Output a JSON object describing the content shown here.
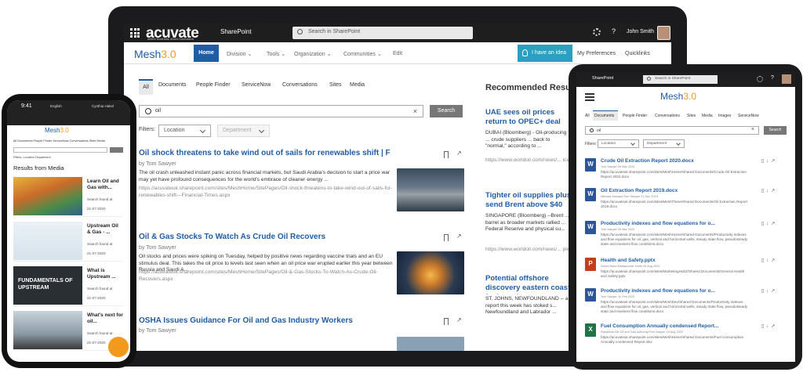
{
  "laptop": {
    "suitebar": {
      "brand": "acuvate",
      "brand_tagline": "where business drives innovation",
      "app": "SharePoint",
      "search_placeholder": "Search in SharePoint",
      "help": "?",
      "user": "John Smith"
    },
    "mesh": {
      "logo_main": "Mesh",
      "logo_ver": "3.0"
    },
    "nav": [
      "Home",
      "Division",
      "Tools",
      "Organization",
      "Communities",
      "Edit"
    ],
    "right_nav": {
      "idea": "I have an idea",
      "prefs": "My Preferences",
      "quick": "Quicklinks"
    },
    "tabs": [
      "All",
      "Documents",
      "People Finder",
      "ServiceNow",
      "Conversations",
      "Sites",
      "Media"
    ],
    "search": {
      "value": "oil",
      "button": "Search",
      "clear": "×"
    },
    "filters": {
      "label": "Filters:",
      "location": "Location",
      "department": "Department"
    },
    "results": [
      {
        "title": "Oil shock threatens to take wind out of sails for renewables shift | Fina...",
        "author": "by Tom Sawyer",
        "snippet": "The oil crash unleashed instant panic across financial markets, but Saudi Arabia's decision to start a price war may yet have profound consequences for the world's embrace of cleaner energy ...",
        "url": "https://acuvateuk.sharepoint.com/sites/MeshHome/SitePages/Oil-shock-threatens-to-take-wind-out-of-sails-for-renewables-shift---Financial-Times.aspx"
      },
      {
        "title": "Oil & Gas Stocks To Watch As Crude Oil Recovers",
        "author": "by Tom Sawyer",
        "snippet": "Oil stocks and prices were spiking on Tuesday, helped by positive news regarding vaccine trials and an EU stimulus deal. This takes the oil price to levels last seen when an oil price war erupted earlier this year between Russia and Saudi A...",
        "url": "https://acuvateuk.sharepoint.com/sites/MeshHome/SitePages/Oil-&-Gas-Stocks-To-Watch-As-Crude-Oil-Recovers.aspx"
      },
      {
        "title": "OSHA Issues Guidance For Oil and Gas Industry Workers",
        "author": "by Tom Sawyer"
      }
    ],
    "recommended": {
      "heading": "Recommended Results",
      "items": [
        {
          "title": "UAE sees oil prices return to OPEC+ deal",
          "body": "DUBAI (Bloomberg) - Oil-producing ... crude suppliers ... back to \"normal,\" according to ...",
          "url": "https://www.worldoil.com/news/... ices-returning-to-normal-on-opec"
        },
        {
          "title": "Tighter oil supplies plus send Brent above $40",
          "body": "SINGAPORE (Bloomberg) --Brent ... barrel as broader markets rallied ... Federal Reserve and physical su...",
          "url": "https://www.worldoil.com/news/... plies-plus-us-stimulus-efforts-se"
        },
        {
          "title": "Potential offshore discovery eastern coast fuels optim",
          "body": "ST. JOHNS, NEWFOUNDLAND -- a report this week has stoked s... Newfoundland and Labrador ..."
        }
      ]
    }
  },
  "phone": {
    "time": "9:41",
    "language": "English",
    "user": "Cynthia Hakel",
    "mesh_logo_main": "Mesh",
    "mesh_logo_ver": "3.0",
    "tabs": "All  Documents  People Finder  ServiceNow  Conversations  Sites  Media",
    "filters": "Filters:  Location  Department",
    "results_heading": "Results from Media",
    "cards": [
      {
        "title": "Learn Oil and Gas with...",
        "meta": "Search found at",
        "date": "21-07-2020"
      },
      {
        "title": "Upstream Oil & Gas - ...",
        "meta": "Search found at",
        "date": "21-07-2020"
      },
      {
        "title": "What is Upstream ...",
        "meta": "Search found at",
        "date": "21-07-2020",
        "thumb_text": "FUNDAMENTALS OF UPSTREAM"
      },
      {
        "title": "What's next for oil...",
        "meta": "Search found at",
        "date": "21-07-2020"
      }
    ]
  },
  "tablet": {
    "app": "SharePoint",
    "search_placeholder": "Search in SharePoint",
    "help": "?",
    "mesh_logo_main": "Mesh",
    "mesh_logo_ver": "3.0",
    "tabs": [
      "All",
      "Documents",
      "People Finder",
      "Conversations",
      "Sites",
      "Media",
      "Images",
      "ServiceNow"
    ],
    "search": {
      "value": "oil",
      "button": "Search",
      "clear": "×"
    },
    "filters": {
      "label": "Filters:",
      "location": "Location",
      "department": "Department"
    },
    "docs": [
      {
        "icon": "W",
        "color": "#2b579a",
        "title": "Crude Oil Extraction Report 2020.docx",
        "meta": "Tom Sawyer                09 Mar 2020",
        "url": "https://acuvateuk.sharepoint.com/sites/MeshHome/Shared Documents/Crude Oil Extraction Report 2020.docx"
      },
      {
        "icon": "W",
        "color": "#2b579a",
        "title": "Oil Extraction Report 2019.docx",
        "meta": "Manasa Manapu/Tom Sawyer              21 Dec 2019",
        "url": "https://acuvateuk.sharepoint.com/sites/MeshThree/Shared Documents/Oil Extraction Report 2019.docx"
      },
      {
        "icon": "W",
        "color": "#2b579a",
        "title": "Productivity indexes and flow equations for o...",
        "meta": "Tom Sawyer                09 Mar 2020",
        "url": "https://acuvateuk.sharepoint.com/sites/MeshHome/Shared Documents/Productivity indexes and flow equations for oil, gas, vertical and horizontal wells, steady state flow, pseudosteady state and transient flow conditions.docx"
      },
      {
        "icon": "P",
        "color": "#c43e1c",
        "title": "Health and Safety.pptx",
        "meta": "Saveri Babu Madapuchiti Smith              06 Aug 2020",
        "url": "https://acuvateuk.sharepoint.com/sites/MarketingHub2/Shared Documents/General Health and Safety.pptx"
      },
      {
        "icon": "W",
        "color": "#2b579a",
        "title": "Productivity indexes and flow equations for o...",
        "meta": "Tom Sawyer                10 Feb 2020",
        "url": "https://acuvateuk.sharepoint.com/sites/MeshDev/Shared Documents/Productivity indexes and flow equations for oil, gas, vertical and horizontal wells, steady state flow, pseudosteady state and transient flow conditions.docx"
      },
      {
        "icon": "X",
        "color": "#217346",
        "title": "Fuel Consumption Annually condensed Report...",
        "meta": "Rosaeede Ale Oil and Gas Authority/Tom Sawyer              18 Aug 2020",
        "url": "https://acuvateuk.sharepoint.com/sites/MeshHome/Shared Documents/Fuel Consumption Annually condensed Report.xlsx"
      }
    ]
  }
}
